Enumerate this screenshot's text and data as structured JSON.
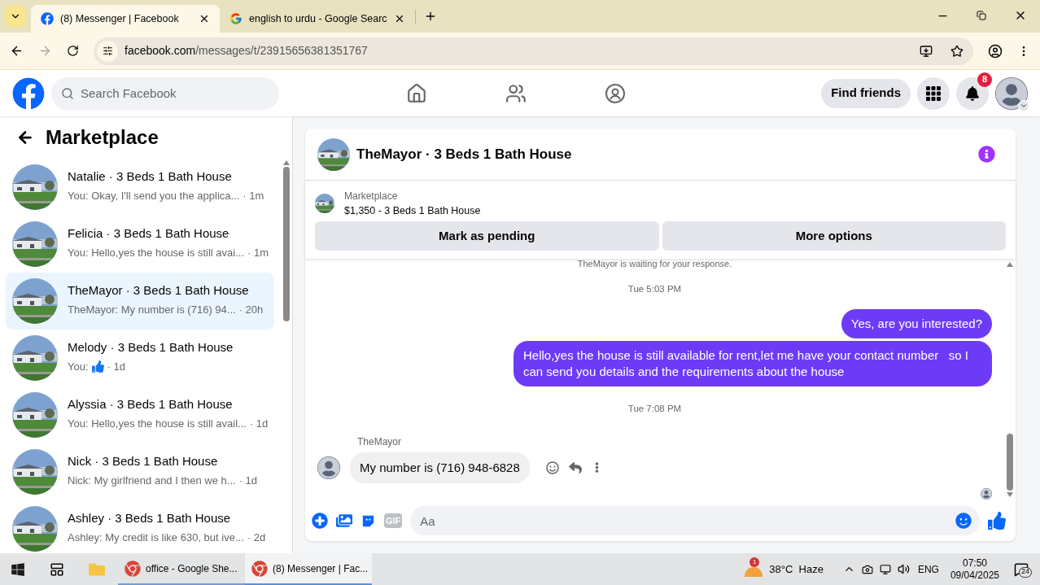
{
  "browser": {
    "tabs": [
      {
        "title": "(8) Messenger | Facebook",
        "selected": true
      },
      {
        "title": "english to urdu - Google Searc",
        "selected": false
      }
    ],
    "url_host": "facebook.com",
    "url_path": "/messages/t/23915656381351767"
  },
  "header": {
    "search_placeholder": "Search Facebook",
    "find_friends": "Find friends",
    "notification_count": "8"
  },
  "sidebar": {
    "title": "Marketplace",
    "conversations": [
      {
        "name": "Natalie · 3 Beds 1 Bath House",
        "kind": "text",
        "preview": "You: Okay, I'll send you the applica...",
        "time": "· 1m",
        "selected": false
      },
      {
        "name": "Felicia · 3 Beds 1 Bath House",
        "kind": "text",
        "preview": "You: Hello,yes the house is still avai...",
        "time": "· 1m",
        "selected": false
      },
      {
        "name": "TheMayor · 3 Beds 1 Bath House",
        "kind": "text",
        "preview": "TheMayor: My number is (716) 94...",
        "time": "· 20h",
        "selected": true
      },
      {
        "name": "Melody · 3 Beds 1 Bath House",
        "kind": "like",
        "preview": "You:",
        "time": "· 1d",
        "selected": false
      },
      {
        "name": "Alyssia · 3 Beds 1 Bath House",
        "kind": "text",
        "preview": "You: Hello,yes the house is still avail...",
        "time": "· 1d",
        "selected": false
      },
      {
        "name": "Nick · 3 Beds 1 Bath House",
        "kind": "text",
        "preview": "Nick: My girlfriend and I then we h...",
        "time": "· 1d",
        "selected": false
      },
      {
        "name": "Ashley · 3 Beds 1 Bath House",
        "kind": "text",
        "preview": "Ashley: My credit is like 630, but ive...",
        "time": "· 2d",
        "selected": false
      }
    ]
  },
  "chat": {
    "title": "TheMayor · 3 Beds 1 Bath House",
    "listing_label": "Marketplace",
    "listing_title": "$1,350 - 3 Beds 1 Bath House",
    "buttons": [
      "Mark as pending",
      "More options"
    ],
    "messages": [
      {
        "kind": "status",
        "text": "TheMayor is waiting for your response."
      },
      {
        "kind": "timestamp",
        "text": "Tue 5:03 PM"
      },
      {
        "kind": "outgoing",
        "text": "Yes, are you interested?"
      },
      {
        "kind": "outgoing",
        "text": "Hello,yes the house is still available for rent,let me have your contact number   so I can send you details and the requirements about the house"
      },
      {
        "kind": "timestamp",
        "text": "Tue 7:08 PM"
      },
      {
        "kind": "incoming",
        "sender": "TheMayor",
        "text": "My number is (716) 948-6828"
      }
    ],
    "composer_placeholder": "Aa",
    "gif_label": "GIF"
  },
  "taskbar": {
    "apps": [
      {
        "title": "office - Google She...",
        "selected": false
      },
      {
        "title": "(8) Messenger | Fac...",
        "selected": true
      }
    ],
    "weather_alerts": "1",
    "weather": "38°C  Haze",
    "language": "ENG",
    "time": "07:50",
    "date": "09/04/2025",
    "notifications": "24"
  }
}
